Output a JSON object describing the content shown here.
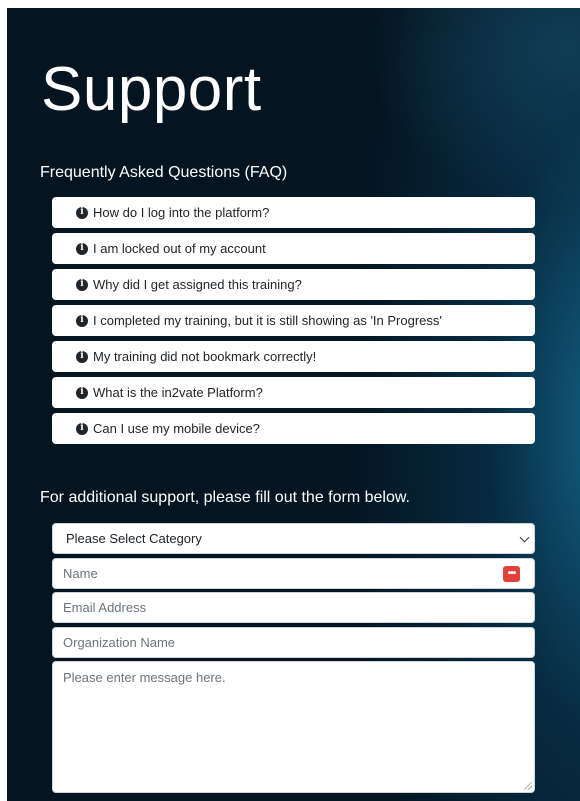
{
  "page": {
    "title": "Support"
  },
  "faq": {
    "heading": "Frequently Asked Questions (FAQ)",
    "icon": "info-circle-icon",
    "items": [
      "How do I log into the platform?",
      "I am locked out of my account",
      "Why did I get assigned this training?",
      "I completed my training, but it is still showing as 'In Progress'",
      "My training did not bookmark correctly!",
      "What is the in2vate Platform?",
      "Can I use my mobile device?"
    ]
  },
  "form": {
    "heading": "For additional support, please fill out the form below.",
    "category": {
      "selected": "Please Select Category"
    },
    "name": {
      "placeholder": "Name"
    },
    "email": {
      "placeholder": "Email Address"
    },
    "organization": {
      "placeholder": "Organization Name"
    },
    "message": {
      "placeholder": "Please enter message here."
    }
  },
  "colors": {
    "background": "#041521",
    "accent_glow": "#146e96",
    "badge": "#e0413a"
  }
}
